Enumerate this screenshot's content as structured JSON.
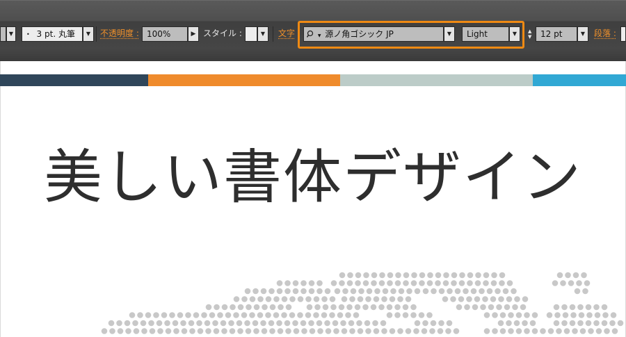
{
  "toolbar": {
    "stroke_profile": "3 pt. 丸筆",
    "opacity_label": "不透明度 :",
    "opacity_value": "100%",
    "style_label": "スタイル :",
    "char_label": "文字",
    "font_family": "源ノ角ゴシック JP",
    "font_style": "Light",
    "font_size": "12 pt",
    "paragraph_label": "段落 :"
  },
  "colors": {
    "accent_orange": "#ef8a13",
    "stripe_1": "#2f465a",
    "stripe_2": "#ef8b2c",
    "stripe_3": "#bcccc8",
    "stripe_4": "#31a8d4",
    "dots": "#c8c8c8"
  },
  "canvas": {
    "headline": "美しい書体デザイン"
  },
  "icons": [
    "bullet-icon",
    "dropdown-arrow-icon",
    "play-arrow-icon",
    "search-icon",
    "stepper-icon"
  ]
}
